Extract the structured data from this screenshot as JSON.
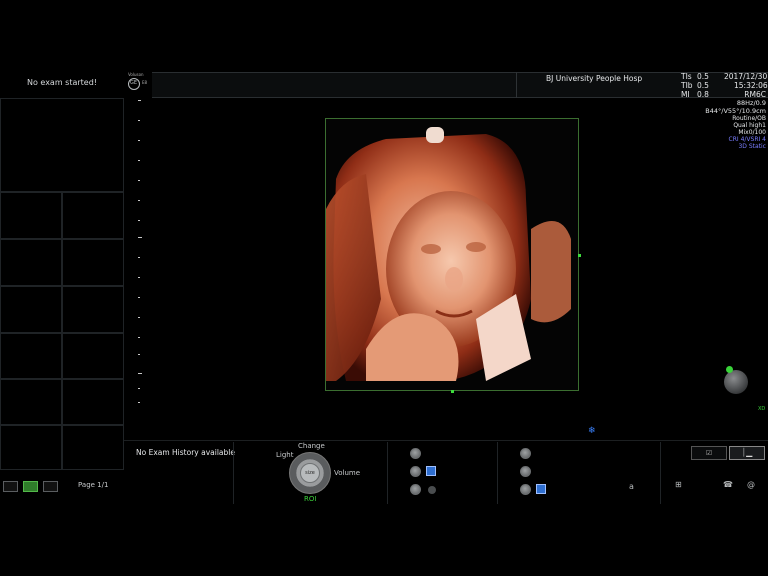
{
  "left_panel": {
    "no_exam_text": "No exam started!"
  },
  "header": {
    "brand": "Voluson",
    "brand_sub": "E8",
    "hospital": "BJ  University  People Hosp",
    "tis_label": "TIs",
    "tis_value": "0.5",
    "tib_label": "TIb",
    "tib_value": "0.5",
    "mi_label": "MI",
    "mi_value": "0.8",
    "date": "2017/12/30",
    "time": "15:32:06"
  },
  "params": {
    "probe": "RM6C",
    "frequency": "88Hz/0.9",
    "angle": "B44°/V55°/10.9cm",
    "mode": "Routine/OB",
    "quality": "Qual high1",
    "mix": "Mix0/100",
    "cri": "CRI 4/VSRI 4",
    "static": "3D Static",
    "accent_color": "#7a7dff"
  },
  "orientation": {
    "label": "XD"
  },
  "bottom": {
    "history_text": "No Exam History available",
    "dial": {
      "top_label": "Change",
      "left_label": "Light",
      "right_label": "Volume",
      "bottom_label": "ROI",
      "center_text": "size"
    },
    "page_label": "Page 1/1",
    "misc_a": "a"
  }
}
